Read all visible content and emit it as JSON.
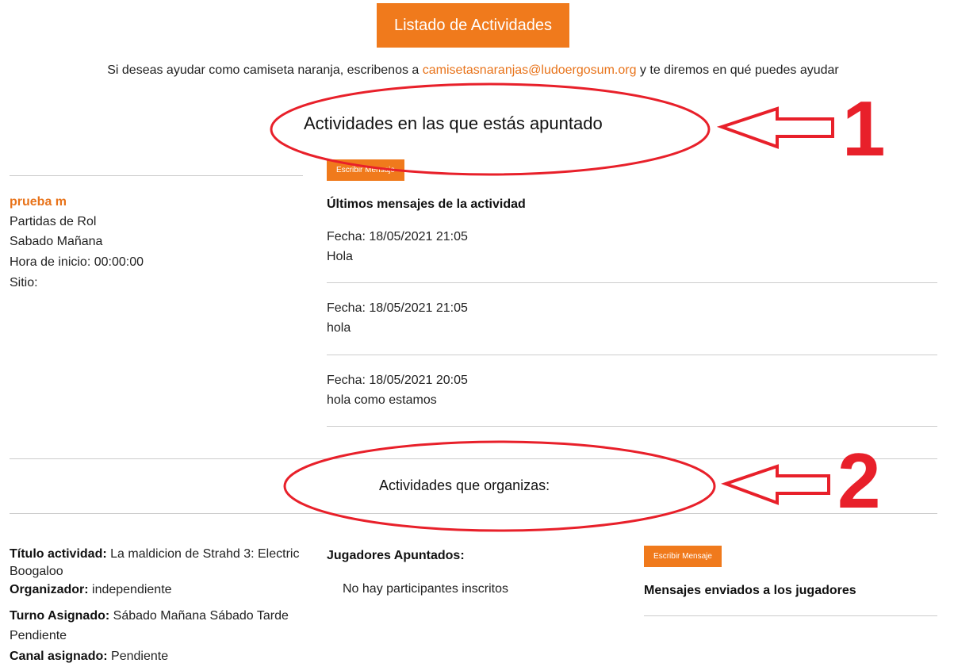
{
  "header": {
    "listado_button": "Listado de Actividades"
  },
  "intro": {
    "prefix": "Si deseas ayudar como camiseta naranja, escribenos a ",
    "email": "camisetasnaranjas@ludoergosum.org",
    "suffix": " y te diremos en qué puedes ayudar"
  },
  "section_enrolled": {
    "title": "Actividades en las que estás apuntado",
    "activity": {
      "name": "prueba m",
      "type": "Partidas de Rol",
      "session": "Sabado Mañana",
      "start_time": "Hora de inicio: 00:00:00",
      "place": "Sitio:"
    },
    "write_button": "Escribir Mensaje",
    "messages_heading": "Últimos mensajes de la actividad",
    "messages": [
      {
        "date": "Fecha: 18/05/2021 21:05",
        "text": "Hola"
      },
      {
        "date": "Fecha: 18/05/2021 21:05",
        "text": "hola"
      },
      {
        "date": "Fecha: 18/05/2021 20:05",
        "text": "hola como estamos"
      }
    ]
  },
  "section_organized": {
    "title": "Actividades que organizas:",
    "details": {
      "title_label": "Título actividad:",
      "title_value": " La maldicion de Strahd 3: Electric Boogaloo",
      "organizer_label": "Organizador:",
      "organizer_value": " independiente",
      "turn_label": "Turno Asignado:",
      "turn_value": " Sábado Mañana Sábado Tarde Pendiente",
      "channel_label": "Canal asignado:",
      "channel_value": " Pendiente"
    },
    "players_heading": "Jugadores Apuntados:",
    "players_empty": "No hay participantes inscritos",
    "write_button": "Escribir Mensaje",
    "sent_heading": "Mensajes enviados a los jugadores"
  },
  "annotations": {
    "marker_1": "1",
    "marker_2": "2",
    "color": "#e8202a"
  }
}
